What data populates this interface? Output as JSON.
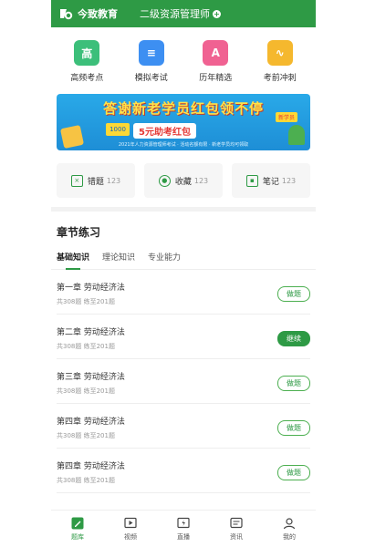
{
  "header": {
    "brand": "今致教育",
    "course": "二级资源管理师",
    "plus": "+"
  },
  "quick": [
    {
      "label": "高频考点",
      "icon": "star-book-icon",
      "glyph": "高",
      "color": "#3cbf7a"
    },
    {
      "label": "模拟考试",
      "icon": "document-icon",
      "glyph": "≡",
      "color": "#3d8ff2"
    },
    {
      "label": "历年精选",
      "icon": "letter-a-icon",
      "glyph": "A",
      "color": "#f06292"
    },
    {
      "label": "考前冲刺",
      "icon": "trend-chart-icon",
      "glyph": "∿",
      "color": "#f5b82e"
    }
  ],
  "banner": {
    "headline": "答谢新老学员红包领不停",
    "ticket": "1000",
    "coupon": "5元助考红包",
    "tag": "新学员",
    "fine": "2021年人力资源管理师考试 · 活动名额有限 · 新老学员均可领取"
  },
  "stats": [
    {
      "label": "错题",
      "count": "123",
      "icon": "wrong-question-icon",
      "glyph": "×"
    },
    {
      "label": "收藏",
      "count": "123",
      "icon": "favorite-icon",
      "glyph": "●"
    },
    {
      "label": "笔记",
      "count": "123",
      "icon": "note-icon",
      "glyph": "▪"
    }
  ],
  "section": {
    "title": "章节练习"
  },
  "tabs": [
    {
      "label": "基础知识",
      "active": true
    },
    {
      "label": "理论知识",
      "active": false
    },
    {
      "label": "专业能力",
      "active": false
    }
  ],
  "chapters": [
    {
      "title": "第一章 劳动经济法",
      "sub": "共308题 练至201题",
      "action": "做题",
      "filled": false
    },
    {
      "title": "第二章 劳动经济法",
      "sub": "共308题 练至201题",
      "action": "继续",
      "filled": true
    },
    {
      "title": "第三章 劳动经济法",
      "sub": "共308题 练至201题",
      "action": "做题",
      "filled": false
    },
    {
      "title": "第四章 劳动经济法",
      "sub": "共308题 练至201题",
      "action": "做题",
      "filled": false
    },
    {
      "title": "第四章 劳动经济法",
      "sub": "共308题 练至201题",
      "action": "做题",
      "filled": false
    }
  ],
  "nav": [
    {
      "label": "题库",
      "icon": "edit-icon",
      "active": true
    },
    {
      "label": "视频",
      "icon": "video-icon",
      "active": false
    },
    {
      "label": "直播",
      "icon": "live-icon",
      "active": false
    },
    {
      "label": "资讯",
      "icon": "news-icon",
      "active": false
    },
    {
      "label": "我的",
      "icon": "profile-icon",
      "active": false
    }
  ],
  "colors": {
    "primary": "#2e9a45",
    "banner": "#29a9e8"
  }
}
